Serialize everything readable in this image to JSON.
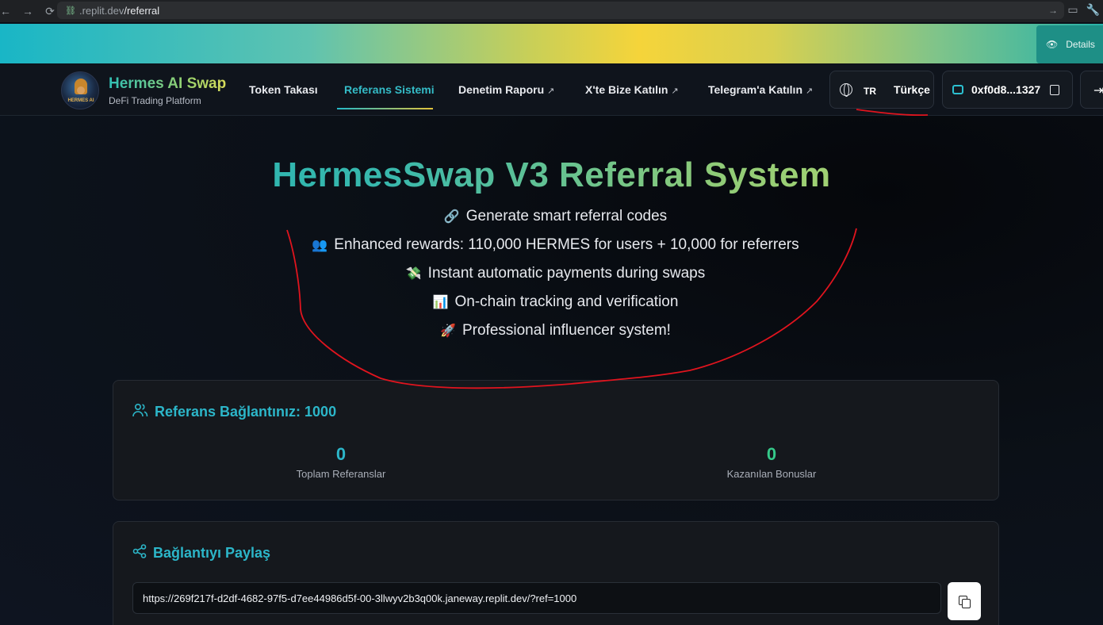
{
  "browser": {
    "url_prefix": ".replit.dev",
    "url_path": "/referral"
  },
  "banner": {
    "details_label": "Details"
  },
  "header": {
    "logo_text": "HERMES AI",
    "brand_title": "Hermes AI Swap",
    "brand_subtitle": "DeFi Trading Platform",
    "nav": [
      {
        "label": "Token Takası",
        "external": false,
        "active": false
      },
      {
        "label": "Referans Sistemi",
        "external": false,
        "active": true
      },
      {
        "label": "Denetim Raporu",
        "external": true,
        "active": false
      },
      {
        "label": "X'te Bize Katılın",
        "external": true,
        "active": false
      },
      {
        "label": "Telegram'a Katılın",
        "external": true,
        "active": false
      }
    ],
    "language": {
      "code": "TR",
      "name": "Türkçe"
    },
    "wallet": {
      "address": "0xf0d8...1327"
    }
  },
  "hero": {
    "title": "HermesSwap V3 Referral System",
    "features": [
      {
        "icon": "🔗",
        "text": "Generate smart referral codes"
      },
      {
        "icon": "👥",
        "text": "Enhanced rewards: 110,000 HERMES for users + 10,000 for referrers"
      },
      {
        "icon": "💸",
        "text": "Instant automatic payments during swaps"
      },
      {
        "icon": "📊",
        "text": "On-chain tracking and verification"
      },
      {
        "icon": "🚀",
        "text": "Professional influencer system!"
      }
    ]
  },
  "referral_card": {
    "title": "Referans Bağlantınız: 1000",
    "total_referrals": {
      "value": "0",
      "label": "Toplam Referanslar"
    },
    "earned_bonuses": {
      "value": "0",
      "label": "Kazanılan Bonuslar"
    }
  },
  "share_card": {
    "title": "Bağlantıyı Paylaş",
    "link": "https://269f217f-d2df-4682-97f5-d7ee44986d5f-00-3llwyv2b3q00k.janeway.replit.dev/?ref=1000"
  },
  "colors": {
    "accent_teal": "#2cb6c9",
    "accent_green": "#35c98a",
    "annotation_red": "#e0141e"
  }
}
